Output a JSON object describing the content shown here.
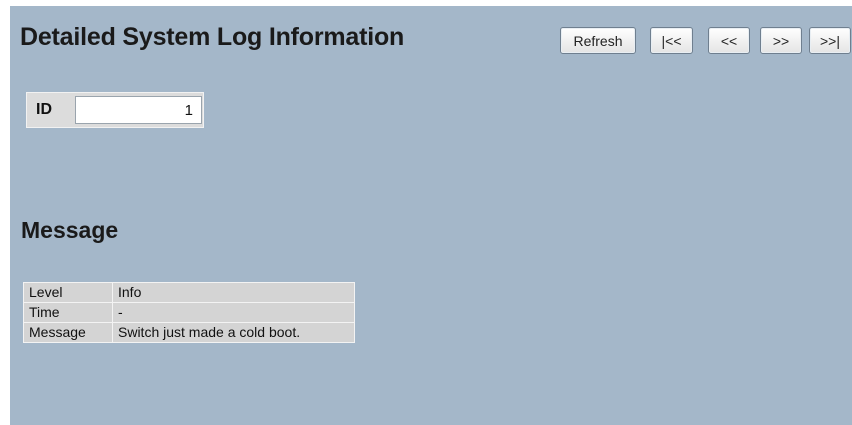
{
  "page": {
    "title": "Detailed System Log Information"
  },
  "toolbar": {
    "refresh_label": "Refresh",
    "first_label": "|<<",
    "prev_label": "<<",
    "next_label": ">>",
    "last_label": ">>|"
  },
  "id_field": {
    "label": "ID",
    "value": "1"
  },
  "message_section": {
    "title": "Message",
    "rows": [
      {
        "key": "Level",
        "value": "Info"
      },
      {
        "key": "Time",
        "value": "-"
      },
      {
        "key": "Message",
        "value": "Switch just made a cold boot."
      }
    ]
  }
}
